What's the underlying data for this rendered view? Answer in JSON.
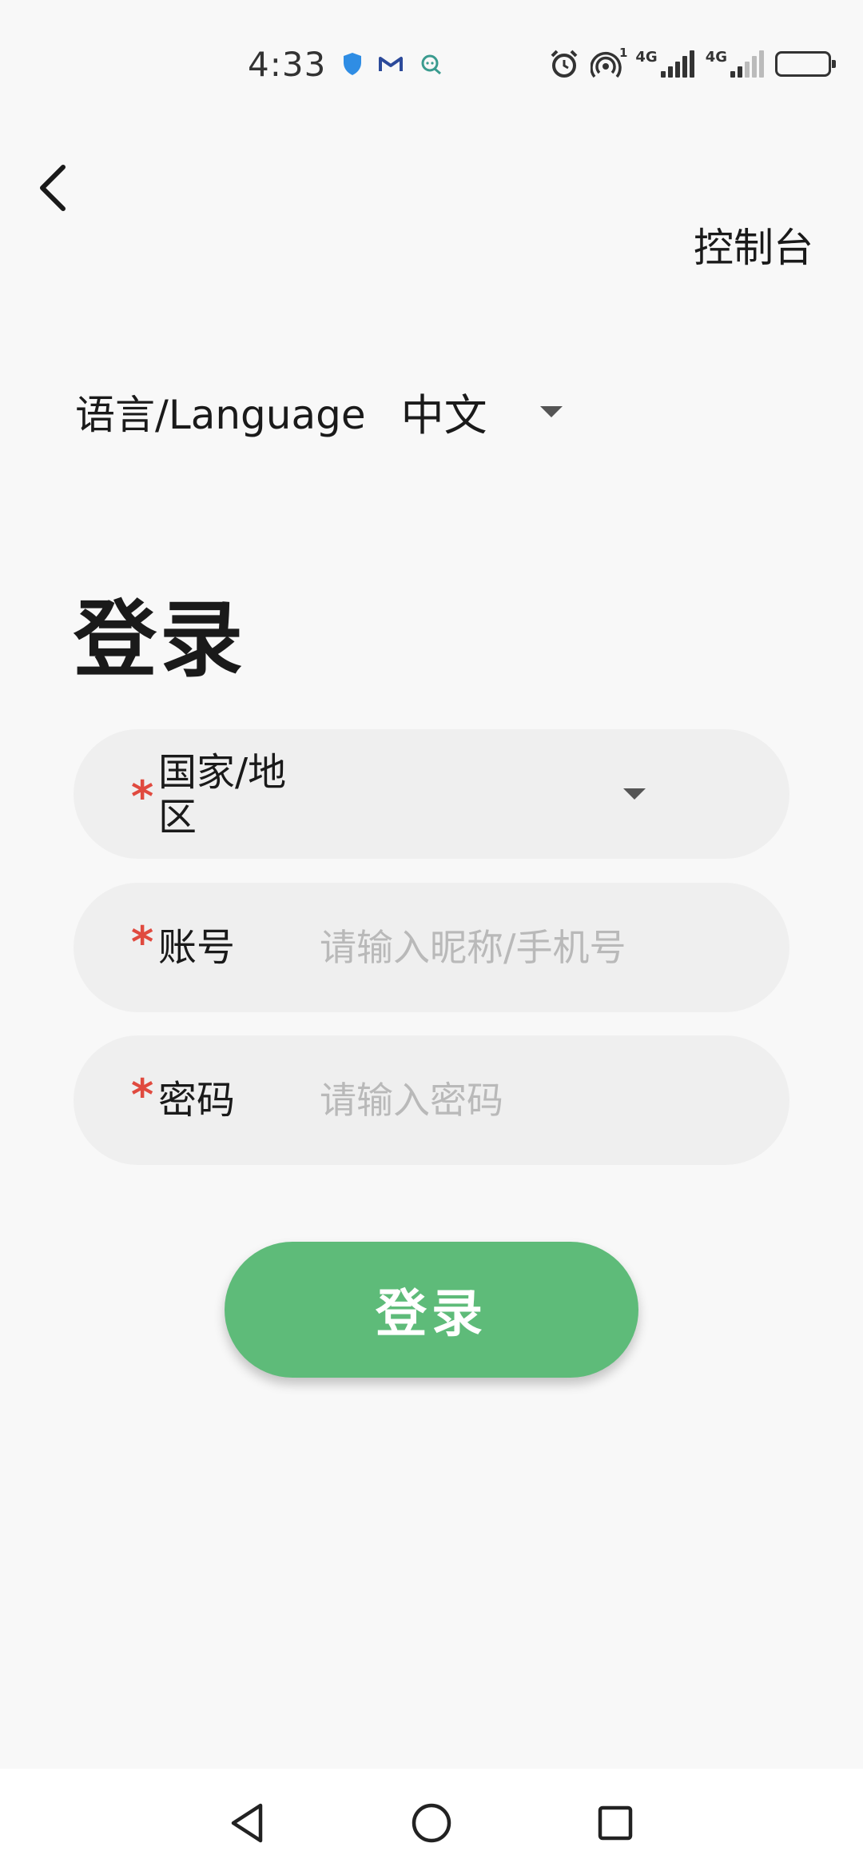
{
  "status_bar": {
    "time": "4:33",
    "left_icons": [
      "shield-icon",
      "gmail-icon",
      "chat-icon"
    ],
    "right_icons": [
      "alarm-icon",
      "hotspot-icon",
      "signal-4g-icon",
      "signal-4g-icon",
      "battery-icon"
    ],
    "hotspot_badge": "1",
    "network_label_1": "4G",
    "network_label_2": "4G"
  },
  "header": {
    "back_icon": "chevron-left-icon",
    "console_label": "控制台"
  },
  "language": {
    "label": "语言/Language",
    "selected": "中文"
  },
  "title": "登录",
  "form": {
    "region": {
      "required_mark": "*",
      "label": "国家/地区",
      "value": ""
    },
    "account": {
      "required_mark": "*",
      "label": "账号",
      "placeholder": "请输入昵称/手机号",
      "value": ""
    },
    "password": {
      "required_mark": "*",
      "label": "密码",
      "placeholder": "请输入密码",
      "value": ""
    }
  },
  "login_button_label": "登录",
  "nav_bar": {
    "icons": [
      "back-triangle-icon",
      "home-circle-icon",
      "recent-square-icon"
    ]
  },
  "colors": {
    "accent_green": "#5ebb79",
    "required_red": "#e04a3f",
    "field_bg": "#efefef",
    "background": "#f8f8f8"
  }
}
